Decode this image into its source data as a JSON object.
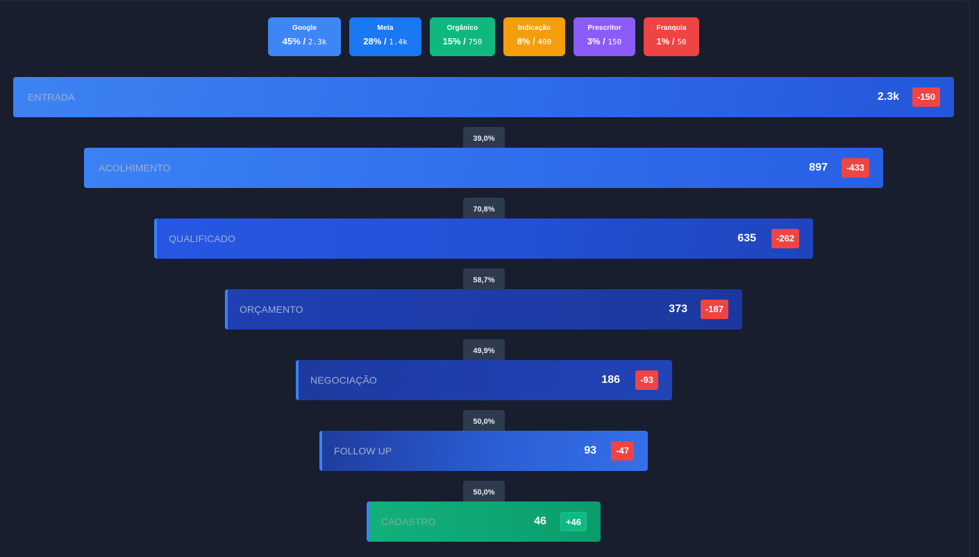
{
  "sources": [
    {
      "name": "Google",
      "percent": "45%",
      "sep": "/",
      "count": "2.3k",
      "color": "#3b82f6"
    },
    {
      "name": "Meta",
      "percent": "28%",
      "sep": "/",
      "count": "1.4k",
      "color": "#1877f2"
    },
    {
      "name": "Orgânico",
      "percent": "15%",
      "sep": "/",
      "count": "750",
      "color": "#10b981"
    },
    {
      "name": "Indicação",
      "percent": "8%",
      "sep": "/",
      "count": "400",
      "color": "#f59e0b"
    },
    {
      "name": "Prescritor",
      "percent": "3%",
      "sep": "/",
      "count": "150",
      "color": "#8b5cf6"
    },
    {
      "name": "Franquia",
      "percent": "1%",
      "sep": "/",
      "count": "50",
      "color": "#ef4444"
    }
  ],
  "stages": [
    {
      "label": "ENTRADA",
      "value": "2.3k",
      "delta": "-150",
      "delta_type": "loss"
    },
    {
      "label": "ACOLHIMENTO",
      "value": "897",
      "delta": "-433",
      "delta_type": "loss"
    },
    {
      "label": "QUALIFICADO",
      "value": "635",
      "delta": "-262",
      "delta_type": "loss"
    },
    {
      "label": "ORÇAMENTO",
      "value": "373",
      "delta": "-187",
      "delta_type": "loss"
    },
    {
      "label": "NEGOCIAÇÃO",
      "value": "186",
      "delta": "-93",
      "delta_type": "loss"
    },
    {
      "label": "FOLLOW UP",
      "value": "93",
      "delta": "-47",
      "delta_type": "loss"
    },
    {
      "label": "CADASTRO",
      "value": "46",
      "delta": "+46",
      "delta_type": "gain"
    }
  ],
  "conversions": [
    "39,0%",
    "70,8%",
    "58,7%",
    "49,9%",
    "50,0%",
    "50,0%"
  ],
  "colors": {
    "background": "#181e2e",
    "loss_badge": "#ef4444",
    "gain_badge": "#10b981",
    "conversion_pill": "#2e3b4f",
    "stage_accent": "#3b82f6"
  }
}
